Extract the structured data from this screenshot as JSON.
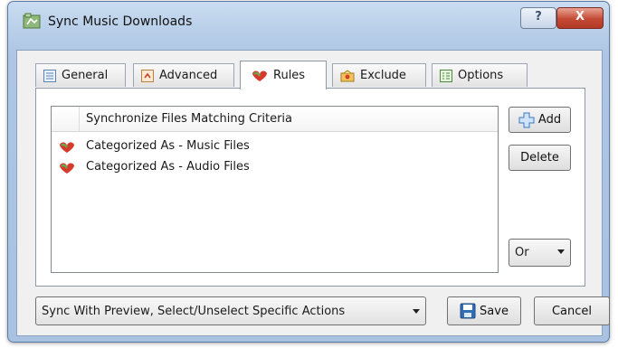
{
  "window": {
    "title": "Sync Music Downloads",
    "help_glyph": "?",
    "close_glyph": "X"
  },
  "tabs": [
    {
      "label": "General",
      "icon": "general-icon"
    },
    {
      "label": "Advanced",
      "icon": "advanced-icon"
    },
    {
      "label": "Rules",
      "icon": "rules-icon",
      "active": true
    },
    {
      "label": "Exclude",
      "icon": "exclude-icon"
    },
    {
      "label": "Options",
      "icon": "options-icon"
    }
  ],
  "rules_list": {
    "column_header": "Synchronize Files Matching Criteria",
    "rows": [
      {
        "text": "Categorized As - Music Files",
        "icon": "rule-icon"
      },
      {
        "text": "Categorized As - Audio Files",
        "icon": "rule-icon"
      }
    ]
  },
  "side_buttons": {
    "add_label": "Add",
    "delete_label": "Delete"
  },
  "logic_select": {
    "value": "Or"
  },
  "footer": {
    "mode_select": "Sync With Preview, Select/Unselect Specific Actions",
    "save_label": "Save",
    "cancel_label": "Cancel"
  },
  "colors": {
    "title_bar": "#b7cde8",
    "close_button": "#c44a34",
    "panel_bg": "#f0f0f0",
    "rule_icon_red": "#d63a2a",
    "rule_icon_green": "#6aa84f"
  }
}
